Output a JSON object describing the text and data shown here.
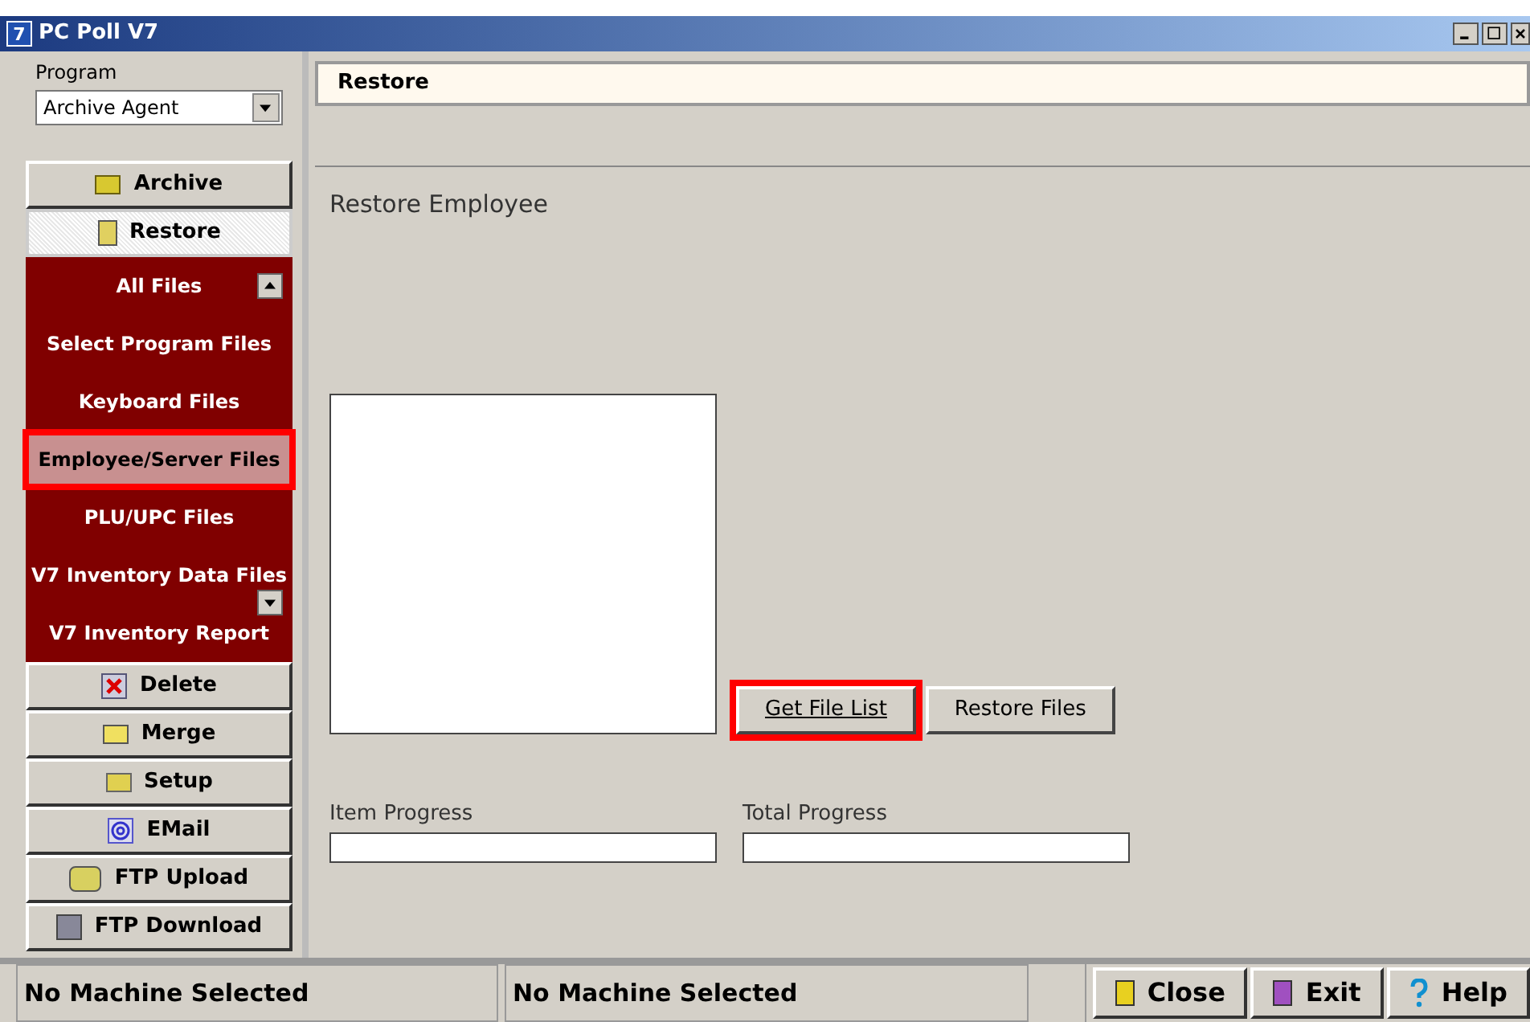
{
  "window": {
    "title": "PC Poll V7",
    "logo": "7"
  },
  "program": {
    "label": "Program",
    "value": "Archive Agent"
  },
  "nav_top": [
    {
      "label": "Archive",
      "selected": false
    },
    {
      "label": "Restore",
      "selected": true
    }
  ],
  "file_list": {
    "items": [
      {
        "label": "All Files",
        "selected": false
      },
      {
        "label": "Select Program Files",
        "selected": false
      },
      {
        "label": "Keyboard Files",
        "selected": false
      },
      {
        "label": "Employee/Server Files",
        "selected": true
      },
      {
        "label": "PLU/UPC Files",
        "selected": false
      },
      {
        "label": "V7 Inventory Data Files",
        "selected": false
      },
      {
        "label": "V7 Inventory Report",
        "selected": false
      }
    ]
  },
  "nav_bottom": [
    {
      "label": "Delete"
    },
    {
      "label": "Merge"
    },
    {
      "label": "Setup"
    },
    {
      "label": "EMail"
    },
    {
      "label": "FTP Upload"
    },
    {
      "label": "FTP Download"
    }
  ],
  "header": "Restore",
  "section_title": "Restore Employee",
  "buttons": [
    {
      "label": "Get File List",
      "focused": true
    },
    {
      "label": "Restore Files",
      "focused": false
    }
  ],
  "progress": [
    {
      "label": "Item Progress",
      "level": 0
    },
    {
      "label": "Total Progress",
      "level": 0
    }
  ],
  "status_bar": [
    "No Machine Selected",
    "No Machine Selected"
  ],
  "footer_buttons": [
    {
      "label": "Close"
    },
    {
      "label": "Exit"
    },
    {
      "label": "Help"
    }
  ]
}
